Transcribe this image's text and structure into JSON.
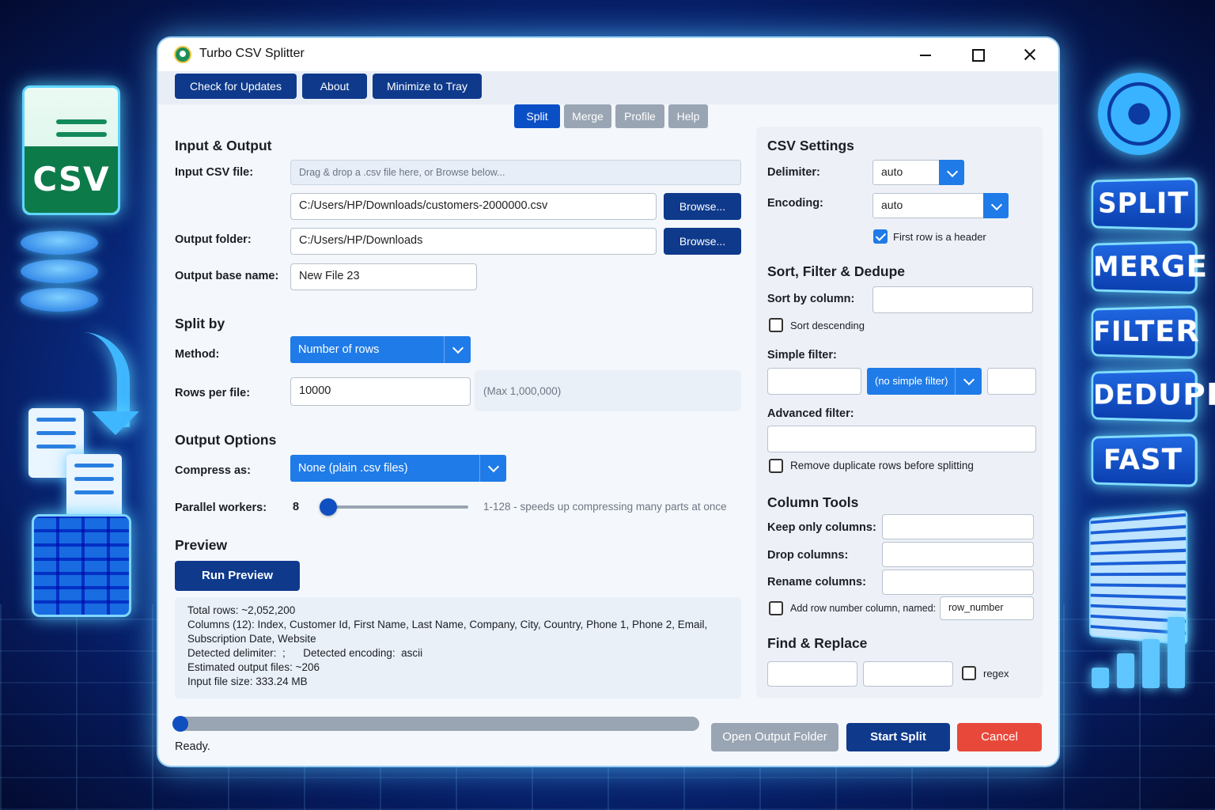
{
  "window": {
    "title": "Turbo CSV Splitter"
  },
  "toolbar": {
    "check_updates": "Check for Updates",
    "about": "About",
    "minimize_tray": "Minimize to Tray"
  },
  "tabs": [
    "Split",
    "Merge",
    "Profile",
    "Help"
  ],
  "input_output": {
    "heading": "Input & Output",
    "input_label": "Input CSV file:",
    "drop_hint": "Drag & drop a .csv file here, or Browse below...",
    "input_path": "C:/Users/HP/Downloads/customers-2000000.csv",
    "browse": "Browse...",
    "output_label": "Output folder:",
    "output_path": "C:/Users/HP/Downloads",
    "base_label": "Output base name:",
    "base_name": "New File 23"
  },
  "split_by": {
    "heading": "Split by",
    "method_label": "Method:",
    "method_value": "Number of rows",
    "rows_label": "Rows per file:",
    "rows_value": "10000",
    "rows_hint": "(Max 1,000,000)"
  },
  "output_options": {
    "heading": "Output Options",
    "compress_label": "Compress as:",
    "compress_value": "None (plain .csv files)",
    "workers_label": "Parallel workers:",
    "workers_value": "8",
    "workers_hint": "1-128  -  speeds up compressing many parts at once",
    "workers_min": 1,
    "workers_max": 128
  },
  "preview": {
    "heading": "Preview",
    "run_button": "Run Preview",
    "lines": [
      "Total rows: ~2,052,200",
      "Columns (12): Index, Customer Id, First Name, Last Name, Company, City, Country, Phone 1, Phone 2, Email,",
      "Subscription Date, Website",
      "Detected delimiter:  ;      Detected encoding:  ascii",
      "Estimated output files: ~206",
      "Input file size:  333.24 MB"
    ]
  },
  "csv_settings": {
    "heading": "CSV Settings",
    "delimiter_label": "Delimiter:",
    "delimiter_value": "auto",
    "encoding_label": "Encoding:",
    "encoding_value": "auto",
    "header_label": "First row is a header",
    "header_checked": true
  },
  "sort_filter": {
    "heading": "Sort, Filter & Dedupe",
    "sort_label": "Sort by column:",
    "sort_value": "",
    "sort_desc_label": "Sort descending",
    "simple_label": "Simple filter:",
    "simple_op": "(no simple filter)",
    "advanced_label": "Advanced filter:",
    "dedupe_label": "Remove duplicate rows before splitting"
  },
  "column_tools": {
    "heading": "Column Tools",
    "keep_label": "Keep only columns:",
    "drop_label": "Drop columns:",
    "rename_label": "Rename columns:",
    "rownum_label": "Add row number column, named:",
    "rownum_value": "row_number"
  },
  "find_replace": {
    "heading": "Find & Replace",
    "regex_label": "regex"
  },
  "footer": {
    "progress": 0.0,
    "status": "Ready.",
    "open_folder": "Open Output Folder",
    "start": "Start Split",
    "cancel": "Cancel"
  },
  "side_art": {
    "csv_label": "CSV",
    "badges": [
      "SPLIT",
      "MERGE",
      "FILTER",
      "DEDUPE",
      "FAST"
    ]
  },
  "colors": {
    "primary_dark": "#0f3a8c",
    "accent": "#1f7be8",
    "cancel": "#e8483a",
    "disabled": "#9aa5b3"
  }
}
